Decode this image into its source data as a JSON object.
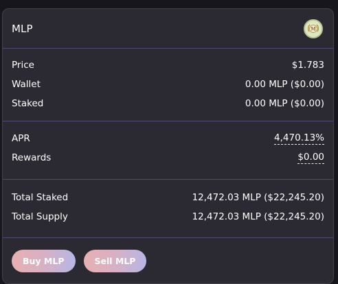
{
  "header": {
    "title": "MLP",
    "icon": "mlp-token-icon",
    "icon_letter": "M"
  },
  "token_info": {
    "price_label": "Price",
    "price_value": "$1.783",
    "wallet_label": "Wallet",
    "wallet_value": "0.00 MLP ($0.00)",
    "staked_label": "Staked",
    "staked_value": "0.00 MLP ($0.00)"
  },
  "rewards_info": {
    "apr_label": "APR",
    "apr_value": "4,470.13%",
    "rewards_label": "Rewards",
    "rewards_value": "$0.00"
  },
  "totals": {
    "total_staked_label": "Total Staked",
    "total_staked_value": "12,472.03 MLP ($22,245.20)",
    "total_supply_label": "Total Supply",
    "total_supply_value": "12,472.03 MLP ($22,245.20)"
  },
  "actions": {
    "buy_label": "Buy MLP",
    "sell_label": "Sell MLP"
  },
  "colors": {
    "card_background": "#2b2a33",
    "divider": "#4e4a73",
    "button_gradient_start": "#e8b0b0",
    "button_gradient_end": "#b7b6e6"
  }
}
